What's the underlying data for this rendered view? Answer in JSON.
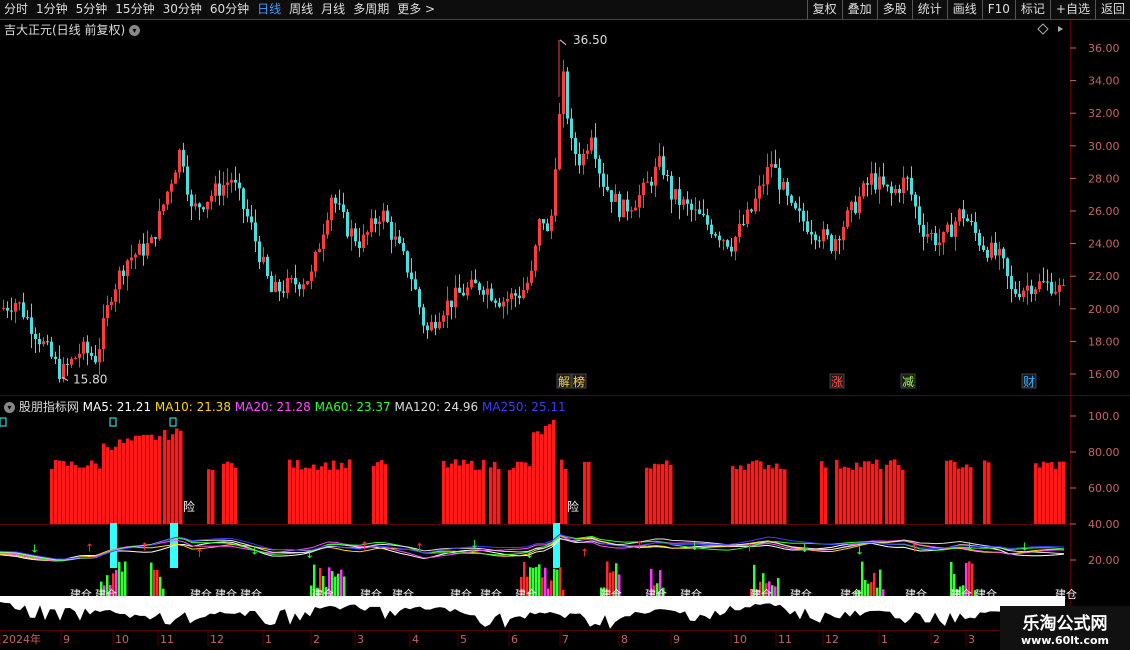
{
  "toolbar": {
    "periods": [
      "分时",
      "1分钟",
      "5分钟",
      "15分钟",
      "30分钟",
      "60分钟",
      "日线",
      "周线",
      "月线",
      "多周期",
      "更多 >"
    ],
    "active_period": "日线",
    "right_buttons": [
      "复权",
      "叠加",
      "多股",
      "统计",
      "画线",
      "F10",
      "标记",
      "+自选",
      "返回"
    ]
  },
  "main_chart": {
    "title": "吉大正元(日线 前复权)",
    "price_axis": [
      "36.00",
      "34.00",
      "32.00",
      "30.00",
      "28.00",
      "26.00",
      "24.00",
      "22.00",
      "20.00",
      "18.00",
      "16.00"
    ],
    "high_label": "36.50",
    "low_label": "15.80",
    "markers": [
      {
        "text": "解",
        "color": "#ffd24d"
      },
      {
        "text": "榜",
        "color": "#ffd24d"
      },
      {
        "text": "涨",
        "color": "#ff5050"
      },
      {
        "text": "减",
        "color": "#9cff52"
      },
      {
        "text": "财",
        "color": "#39b0ff"
      }
    ]
  },
  "indicator": {
    "name": "股朋指标网",
    "mas": [
      {
        "label": "MA5: 21.21",
        "color": "#ffffff"
      },
      {
        "label": "MA10: 21.38",
        "color": "#ffd700"
      },
      {
        "label": "MA20: 21.28",
        "color": "#ff4dff"
      },
      {
        "label": "MA60: 23.37",
        "color": "#33ff33"
      },
      {
        "label": "MA120: 24.96",
        "color": "#dddddd"
      },
      {
        "label": "MA250: 25.11",
        "color": "#3c3cff"
      }
    ],
    "axis": [
      "100.0",
      "80.00",
      "60.00",
      "40.00",
      "20.00"
    ],
    "risk_label": "险",
    "build_label": "建仓"
  },
  "date_axis": [
    "2024年",
    "9",
    "10",
    "11",
    "12",
    "1",
    "2",
    "3",
    "4",
    "5",
    "6",
    "7",
    "8",
    "9",
    "10",
    "11",
    "12",
    "1",
    "2",
    "3"
  ],
  "watermark": {
    "title": "乐淘公式网",
    "url": "www.60lt.com"
  },
  "colors": {
    "up": "#ff3b3b",
    "down": "#46e0e0",
    "background": "#000000",
    "grid": "#5a0000",
    "axis_text": "#c86464"
  }
}
